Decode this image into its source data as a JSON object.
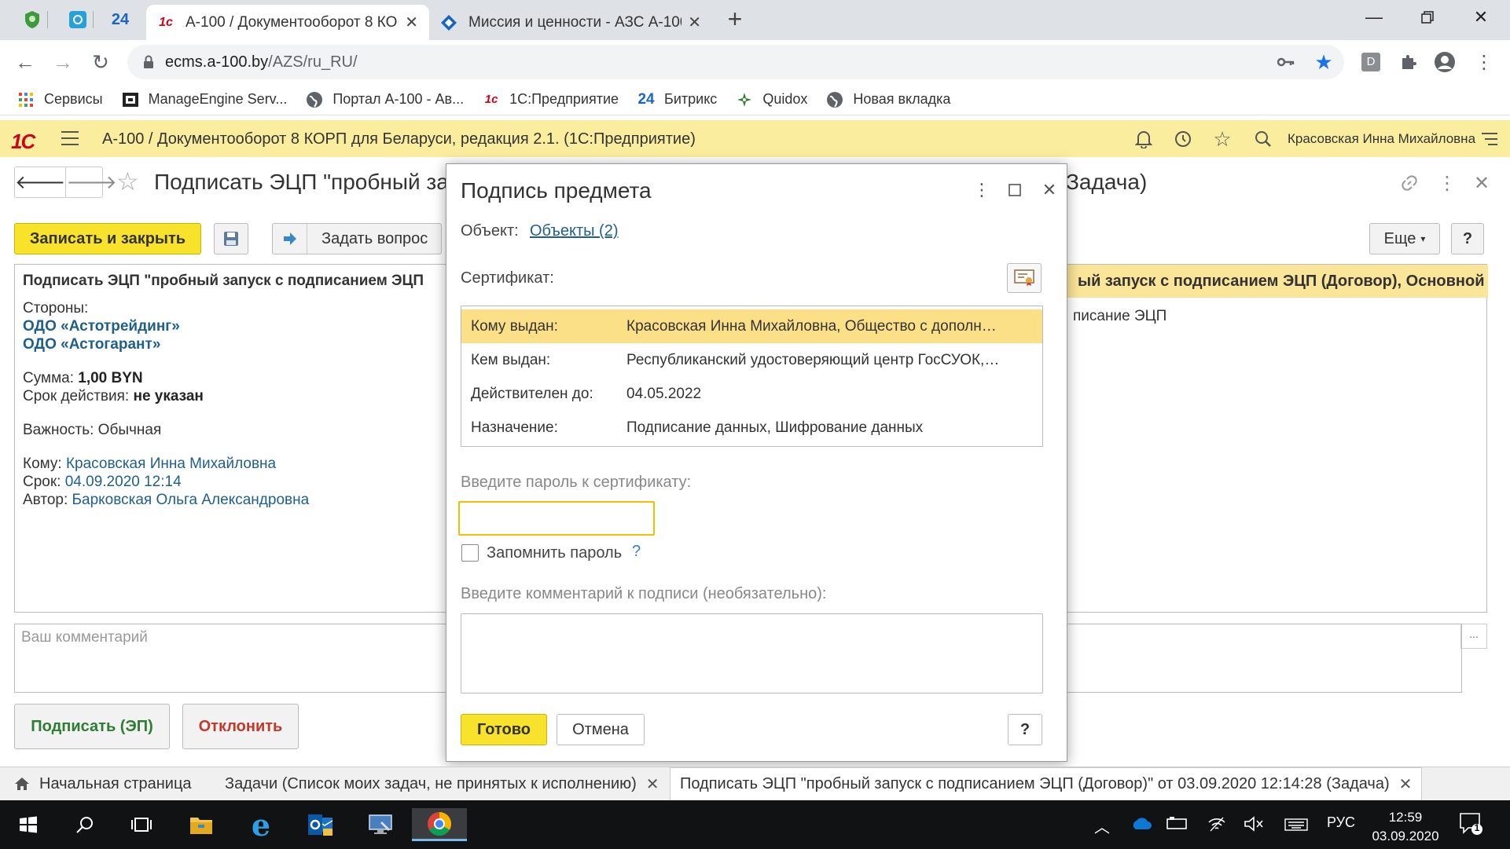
{
  "browser": {
    "pinned_tabs": [
      {
        "icon": "vpn-green-icon"
      },
      {
        "icon": "screen-blue-icon"
      },
      {
        "icon": "bitrix24-icon",
        "text": "24"
      }
    ],
    "tabs": [
      {
        "title": "А-100 / Документооборот 8 КОРП",
        "icon": "1c-favicon",
        "active": true
      },
      {
        "title": "Миссия и ценности - АЗС А-100",
        "icon": "a100-diamond-icon",
        "active": false
      }
    ],
    "url_host": "ecms.a-100.by",
    "url_path": "/AZS/ru_RU/",
    "profile_letter": "D",
    "bookmarks": [
      {
        "label": "Сервисы",
        "icon": "apps-grid-icon"
      },
      {
        "label": "ManageEngine Serv...",
        "icon": "manageengine-icon"
      },
      {
        "label": "Портал А-100 - Ав...",
        "icon": "globe-icon"
      },
      {
        "label": "1С:Предприятие",
        "icon": "1c-icon"
      },
      {
        "label": "Битрикс",
        "icon": "bitrix24-icon",
        "prefix": "24"
      },
      {
        "label": "Quidox",
        "icon": "quidox-icon"
      },
      {
        "label": "Новая вкладка",
        "icon": "globe-icon"
      }
    ]
  },
  "app": {
    "logo": "1С",
    "title": "А-100 / Документооборот 8 КОРП для Беларуси, редакция 2.1.  (1С:Предприятие)",
    "user": "Красовская Инна Михайловна"
  },
  "form": {
    "title_left": "Подписать ЭЦП \"пробный за",
    "title_right": "Задача)",
    "save_close": "Записать и закрыть",
    "ask_question": "Задать вопрос",
    "more": "Еще",
    "help": "?",
    "doc_header_left": "Подписать ЭЦП \"пробный запуск с подписанием ЭЦП",
    "doc_header_right": "ый запуск с подписанием ЭЦП (Договор), Основной",
    "doc_sub_right": "писание ЭЦП",
    "parties_label": "Стороны:",
    "party1": "ОДО «Астотрейдинг»",
    "party2": "ОДО «Астогарант»",
    "sum_label": "Сумма: ",
    "sum_value": "1,00 BYN",
    "validity_label": "Срок действия: ",
    "validity_value": "не указан",
    "importance_label": "Важность: ",
    "importance_value": "Обычная",
    "to_label": "Кому: ",
    "to_value": "Красовская Инна Михайловна",
    "due_label": "Срок: ",
    "due_value": "04.09.2020 12:14",
    "author_label": "Автор: ",
    "author_value": "Барковская Ольга Александровна",
    "comment_placeholder": "Ваш комментарий",
    "comment_more": "...",
    "sign_button": "Подписать (ЭП)",
    "reject_button": "Отклонить"
  },
  "dialog": {
    "title": "Подпись предмета",
    "object_label": "Объект:",
    "object_link": "Объекты (2)",
    "certificate_label": "Сертификат:",
    "cert_rows": [
      {
        "key": "Кому выдан:",
        "value": "Красовская Инна Михайловна, Общество с дополн…",
        "selected": true
      },
      {
        "key": "Кем выдан:",
        "value": "Республиканский удостоверяющий центр ГосСУОК,…",
        "selected": false
      },
      {
        "key": "Действителен до:",
        "value": "04.05.2022",
        "selected": false
      },
      {
        "key": "Назначение:",
        "value": "Подписание данных, Шифрование данных",
        "selected": false
      }
    ],
    "password_label": "Введите пароль к сертификату:",
    "password_value": "",
    "remember_label": "Запомнить пароль",
    "remember_checked": false,
    "remember_help": "?",
    "comment_label": "Введите комментарий к подписи (необязательно):",
    "comment_value": "",
    "ok_button": "Готово",
    "cancel_button": "Отмена",
    "help_button": "?"
  },
  "app_tabs": [
    {
      "label": "Начальная страница",
      "icon": "home-icon",
      "active": false,
      "closable": false
    },
    {
      "label": "Задачи (Список моих задач, не принятых к исполнению)",
      "active": false,
      "closable": true
    },
    {
      "label": "Подписать ЭЦП \"пробный запуск с подписанием ЭЦП (Договор)\" от 03.09.2020 12:14:28 (Задача)",
      "active": true,
      "closable": true
    }
  ],
  "taskbar": {
    "language": "РУС",
    "time": "12:59",
    "date": "03.09.2020",
    "notification_count": "1"
  },
  "colors": {
    "c1_header": "#fbed9e",
    "accent_yellow": "#f9e22b",
    "link_blue": "#1f5f8b",
    "selected_row": "#fbe088",
    "focus_border": "#f0c000",
    "reject_red": "#c0392b",
    "sign_green": "#2e7d32"
  }
}
